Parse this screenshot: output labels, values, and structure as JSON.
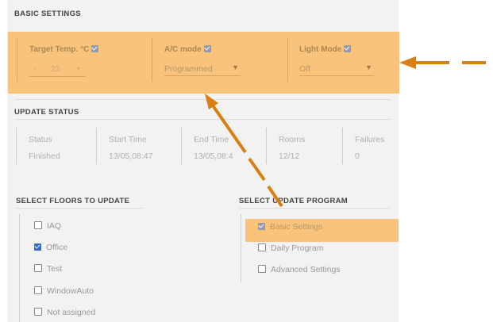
{
  "basic_settings": {
    "title": "BASIC SETTINGS",
    "target_temp": {
      "label": "Target Temp. °C",
      "minus": "-",
      "value": "23",
      "plus": "+"
    },
    "ac_mode": {
      "label": "A/C mode",
      "value": "Programmed"
    },
    "light_mode": {
      "label": "Light Mode",
      "value": "Off"
    }
  },
  "update_status": {
    "title": "UPDATE STATUS",
    "columns": [
      {
        "header": "Status",
        "value": "Finished"
      },
      {
        "header": "Start Time",
        "value": "13/05,08:47"
      },
      {
        "header": "End Time",
        "value": "13/05,08:4"
      },
      {
        "header": "Rooms",
        "value": "12/12"
      },
      {
        "header": "Failures",
        "value": "0"
      }
    ]
  },
  "floors": {
    "title": "SELECT FLOORS TO UPDATE",
    "items": [
      {
        "label": "IAQ",
        "checked": false
      },
      {
        "label": "Office",
        "checked": true
      },
      {
        "label": "Test",
        "checked": false
      },
      {
        "label": "WindowAuto",
        "checked": false
      },
      {
        "label": "Not assigned",
        "checked": false
      }
    ]
  },
  "program": {
    "title": "SELECT UPDATE PROGRAM",
    "items": [
      {
        "label": "Basic Settings",
        "checked": true
      },
      {
        "label": "Daily Program",
        "checked": false
      },
      {
        "label": "Advanced Settings",
        "checked": false
      }
    ]
  },
  "colors": {
    "highlight": "#f9c37b",
    "arrow": "#d97f0f",
    "checkbox_blue": "#2f6ad3"
  }
}
